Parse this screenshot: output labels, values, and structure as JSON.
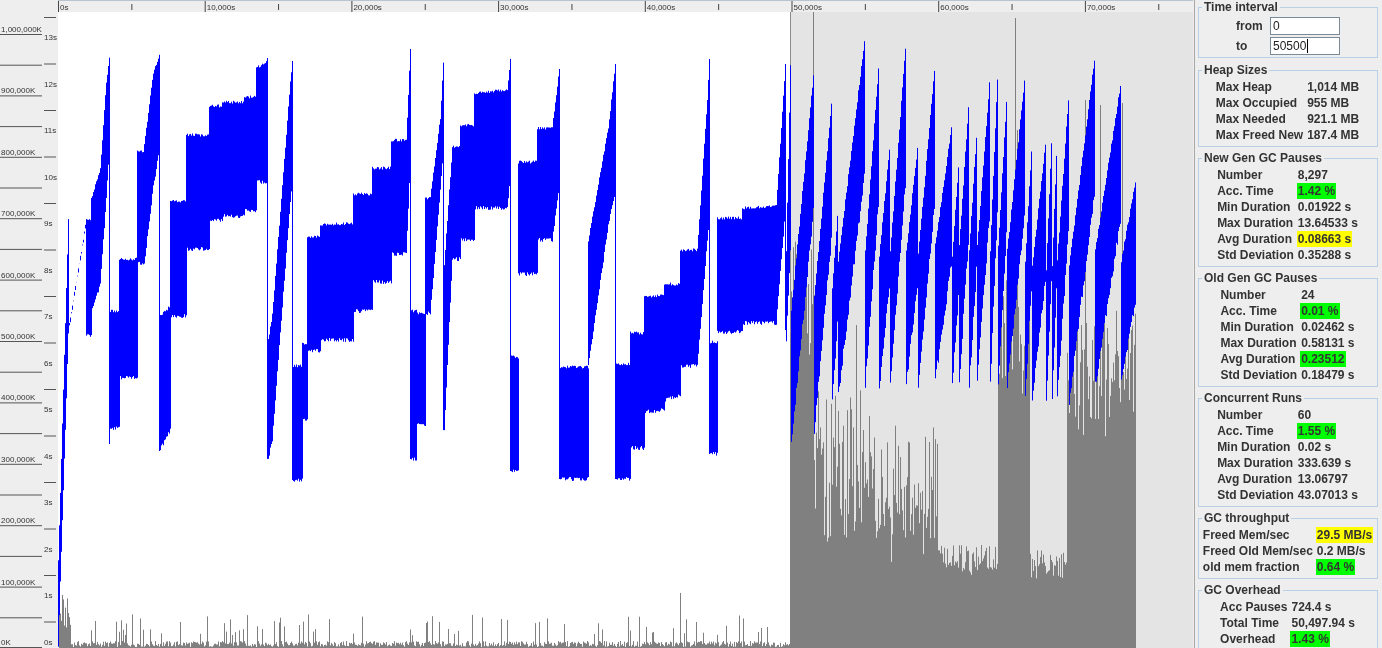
{
  "chart": {
    "time_axis_labels": [
      "0s",
      "10,000s",
      "20,000s",
      "30,000s",
      "40,000s",
      "50,000s",
      "60,000s",
      "70,000s"
    ],
    "heap_axis_labels": [
      "1,000,000K",
      "900,000K",
      "800,000K",
      "700,000K",
      "600,000K",
      "500,000K",
      "400,000K",
      "300,000K",
      "200,000K",
      "100,000K",
      "0K"
    ],
    "pause_axis_labels": [
      "13s",
      "12s",
      "11s",
      "10s",
      "9s",
      "8s",
      "7s",
      "6s",
      "5s",
      "4s",
      "3s",
      "2s",
      "1s",
      "0s"
    ]
  },
  "time_interval": {
    "title": "Time interval",
    "fields": [
      {
        "label": "from",
        "value": "0",
        "focused": false
      },
      {
        "label": "to",
        "value": "50500",
        "focused": true
      }
    ]
  },
  "sections": [
    {
      "title": "Heap Sizes",
      "rows": [
        {
          "label": "Max Heap",
          "value": "1,014 MB"
        },
        {
          "label": "Max Occupied",
          "value": "955 MB"
        },
        {
          "label": "Max Needed",
          "value": "921.1 MB"
        },
        {
          "label": "Max Freed New",
          "value": "187.4 MB"
        }
      ]
    },
    {
      "title": "New Gen GC Pauses",
      "rows": [
        {
          "label": "Number",
          "value": "8,297"
        },
        {
          "label": "Acc. Time",
          "value": "1.42 %",
          "color": "#00ff00"
        },
        {
          "label": "Min Duration",
          "value": "0.01922 s"
        },
        {
          "label": "Max Duration",
          "value": "13.64533 s"
        },
        {
          "label": "Avg Duration",
          "value": "0.08663 s",
          "color": "#ffff00"
        },
        {
          "label": "Std Deviation",
          "value": "0.35288 s"
        }
      ]
    },
    {
      "title": "Old Gen GC Pauses",
      "rows": [
        {
          "label": "Number",
          "value": "24"
        },
        {
          "label": "Acc. Time",
          "value": "0.01 %",
          "color": "#00ff00"
        },
        {
          "label": "Min Duration",
          "value": "0.02462 s"
        },
        {
          "label": "Max Duration",
          "value": "0.58131 s"
        },
        {
          "label": "Avg Duration",
          "value": "0.23512",
          "color": "#00ff00"
        },
        {
          "label": "Std Deviation",
          "value": "0.18479 s"
        }
      ]
    },
    {
      "title": "Concurrent Runs",
      "rows": [
        {
          "label": "Number",
          "value": "60"
        },
        {
          "label": "Acc. Time",
          "value": "1.55 %",
          "color": "#00ff00"
        },
        {
          "label": "Min Duration",
          "value": "0.02 s"
        },
        {
          "label": "Max Duration",
          "value": "333.639 s"
        },
        {
          "label": "Avg Duration",
          "value": "13.06797"
        },
        {
          "label": "Std Deviation",
          "value": "43.07013 s"
        }
      ]
    },
    {
      "title": "GC throughput",
      "rows": [
        {
          "label": "Freed Mem/sec",
          "value": "29.5 MB/s",
          "color": "#ffff00"
        },
        {
          "label": "Freed Old Mem/sec",
          "value": "0.2 MB/s"
        },
        {
          "label": "old mem fraction",
          "value": "0.64 %",
          "color": "#00ff00"
        }
      ]
    },
    {
      "title": "GC Overhead",
      "rows": [
        {
          "label": "Acc Pauses",
          "value": "724.4 s"
        },
        {
          "label": "Total Time",
          "value": "50,497.94 s"
        },
        {
          "label": "Overhead",
          "value": "1.43 %",
          "color": "#00ff00"
        }
      ]
    }
  ]
}
